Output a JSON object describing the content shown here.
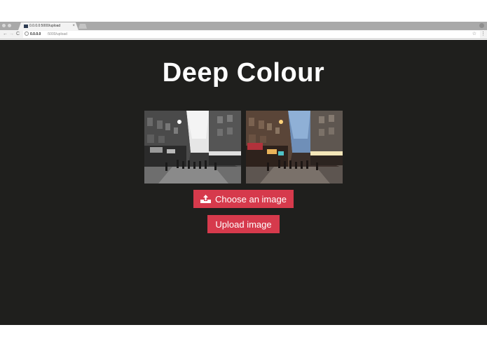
{
  "browser": {
    "tab_title": "0.0.0.0:5000/upload",
    "tab_close": "×",
    "url_host": "0.0.0.0",
    "url_path": ":5000/upload",
    "back": "←",
    "forward": "→",
    "reload": "C",
    "star": "☆",
    "menu": "⋮"
  },
  "page": {
    "title": "Deep Colour",
    "photos": [
      {
        "label": "grayscale street photo",
        "mode": "grayscale"
      },
      {
        "label": "colourised street photo",
        "mode": "color"
      }
    ],
    "choose_button": {
      "label": "Choose an image",
      "icon": "upload-icon"
    },
    "upload_button": {
      "label": "Upload image"
    }
  },
  "colors": {
    "page_background": "#1f1f1d",
    "button": "#d63a4c",
    "text": "#ffffff"
  }
}
